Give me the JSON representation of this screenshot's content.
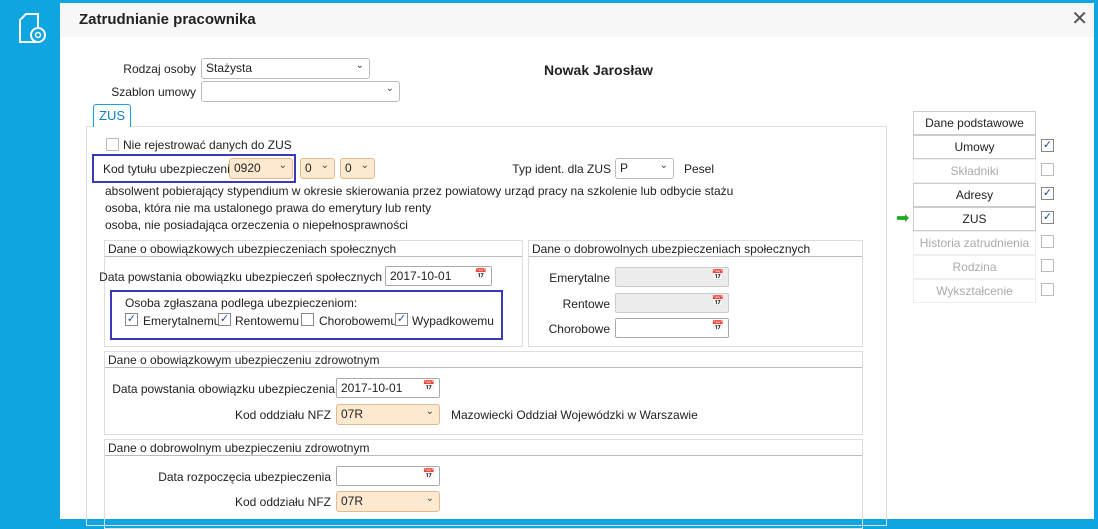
{
  "window": {
    "title": "Zatrudnianie pracownika",
    "close": "✕",
    "app_icon": "document-gear-icon"
  },
  "person_name": "Nowak Jarosław",
  "rodzaj_osoby": {
    "label": "Rodzaj osoby",
    "value": "Stażysta"
  },
  "szablon_umowy": {
    "label": "Szablon umowy",
    "value": ""
  },
  "tab": "ZUS",
  "nie_rejestrowac": {
    "label": "Nie rejestrować danych do ZUS",
    "checked": false
  },
  "kod_tytulu": {
    "label": "Kod tytułu ubezpieczenia",
    "value": "0920",
    "v2": "0",
    "v3": "0"
  },
  "typ_ident": {
    "label": "Typ ident. dla ZUS",
    "value": "P",
    "desc": "Pesel"
  },
  "desc_lines": [
    "absolwent pobierający stypendium w okresie skierowania przez powiatowy urząd pracy na szkolenie lub odbycie stażu",
    "osoba, która nie ma ustalonego prawa do emerytury lub renty",
    "osoba, nie posiadająca orzeczenia o niepełnosprawności"
  ],
  "mandatory_social": {
    "title": "Dane o obowiązkowych ubezpieczeniach społecznych",
    "date_label": "Data powstania obowiązku ubezpieczeń społecznych",
    "date": "2017-10-01",
    "subject_label": "Osoba zgłaszana podlega ubezpieczeniom:",
    "items": [
      {
        "label": "Emerytalnemu",
        "checked": true
      },
      {
        "label": "Rentowemu",
        "checked": true
      },
      {
        "label": "Chorobowemu",
        "checked": false
      },
      {
        "label": "Wypadkowemu",
        "checked": true
      }
    ]
  },
  "voluntary_social": {
    "title": "Dane o dobrowolnych ubezpieczeniach społecznych",
    "emerytalne": "Emerytalne",
    "rentowe": "Rentowe",
    "chorobowe": "Chorobowe"
  },
  "mandatory_health": {
    "title": "Dane o obowiązkowym ubezpieczeniu zdrowotnym",
    "date_label": "Data powstania obowiązku ubezpieczenia",
    "date": "2017-10-01",
    "nfz_label": "Kod oddziału NFZ",
    "nfz": "07R",
    "nfz_desc": "Mazowiecki Oddział Wojewódzki w Warszawie"
  },
  "voluntary_health": {
    "title": "Dane o dobrowolnym ubezpieczeniu zdrowotnym",
    "date_label": "Data rozpoczęcia ubezpieczenia",
    "date": "",
    "nfz_label": "Kod oddziału NFZ",
    "nfz": "07R"
  },
  "nav": [
    {
      "label": "Dane podstawowe",
      "enabled": true,
      "checked": null
    },
    {
      "label": "Umowy",
      "enabled": true,
      "checked": true
    },
    {
      "label": "Składniki",
      "enabled": false,
      "checked": false
    },
    {
      "label": "Adresy",
      "enabled": true,
      "checked": true
    },
    {
      "label": "ZUS",
      "enabled": true,
      "checked": true,
      "current": true
    },
    {
      "label": "Historia zatrudnienia",
      "enabled": false,
      "checked": false
    },
    {
      "label": "Rodzina",
      "enabled": false,
      "checked": false
    },
    {
      "label": "Wykształcenie",
      "enabled": false,
      "checked": false
    }
  ],
  "colors": {
    "accent": "#0ea5e0",
    "highlight": "#3a3ab8",
    "required_field": "#fde9cf",
    "current_arrow": "#22aa22"
  }
}
